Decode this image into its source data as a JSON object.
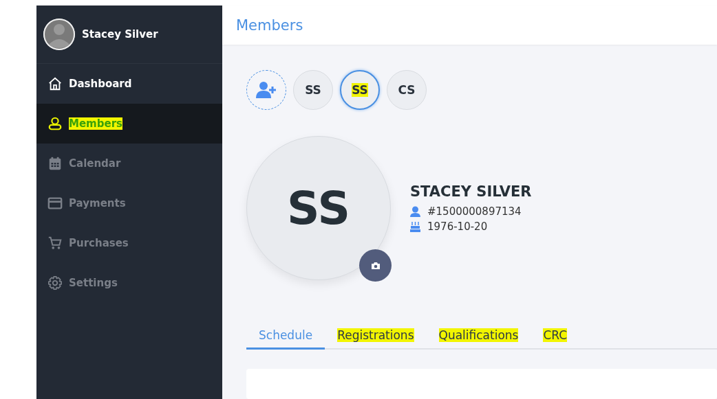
{
  "sidebar": {
    "user": {
      "name": "Stacey Silver"
    },
    "items": [
      {
        "label": "Dashboard",
        "selected": false,
        "dimmed": false,
        "highlighted": false
      },
      {
        "label": "Members",
        "selected": true,
        "dimmed": false,
        "highlighted": true
      },
      {
        "label": "Calendar",
        "selected": false,
        "dimmed": true,
        "highlighted": false
      },
      {
        "label": "Payments",
        "selected": false,
        "dimmed": true,
        "highlighted": false
      },
      {
        "label": "Purchases",
        "selected": false,
        "dimmed": true,
        "highlighted": false
      },
      {
        "label": "Settings",
        "selected": false,
        "dimmed": true,
        "highlighted": false
      }
    ]
  },
  "header": {
    "title": "Members"
  },
  "member_chips": [
    {
      "initials": "SS",
      "selected": false,
      "highlighted": false
    },
    {
      "initials": "SS",
      "selected": true,
      "highlighted": true
    },
    {
      "initials": "CS",
      "selected": false,
      "highlighted": false
    }
  ],
  "profile": {
    "initials": "SS",
    "name": "STACEY SILVER",
    "member_number": "#1500000897134",
    "birth_date": "1976-10-20"
  },
  "tabs": [
    {
      "label": "Schedule",
      "selected": true,
      "highlighted": false
    },
    {
      "label": "Registrations",
      "selected": false,
      "highlighted": true
    },
    {
      "label": "Qualifications",
      "selected": false,
      "highlighted": true
    },
    {
      "label": "CRC",
      "selected": false,
      "highlighted": true
    }
  ]
}
